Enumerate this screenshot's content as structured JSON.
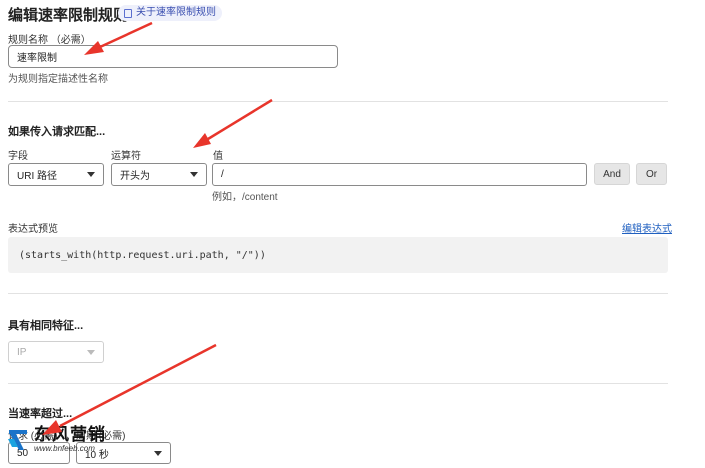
{
  "header": {
    "title": "编辑速率限制规则",
    "doc_link": "关于速率限制规则"
  },
  "rule_name": {
    "label": "规则名称 （必需）",
    "value": "速率限制",
    "hint": "为规则指定描述性名称"
  },
  "match": {
    "heading": "如果传入请求匹配...",
    "field_label": "字段",
    "operator_label": "运算符",
    "value_label": "值",
    "field_value": "URI 路径",
    "operator_value": "开头为",
    "value_value": "/",
    "value_hint": "例如，/content",
    "and_button": "And",
    "or_button": "Or"
  },
  "expression": {
    "label": "表达式预览",
    "edit_link": "编辑表达式",
    "code": "(starts_with(http.request.uri.path, \"/\"))"
  },
  "characteristics": {
    "heading": "具有相同特征...",
    "select_value": "IP"
  },
  "rate": {
    "heading": "当速率超过...",
    "requests_label": "请求 (必需)",
    "period_label": "周期 (必需)",
    "requests_value": "50",
    "period_value": "10 秒"
  },
  "watermark": {
    "name": "东风营销",
    "url": "www.bnfeeb.com"
  },
  "colors": {
    "arrow": "#e8352b",
    "link": "#2060c0",
    "badge_bg": "#eef0fb"
  }
}
